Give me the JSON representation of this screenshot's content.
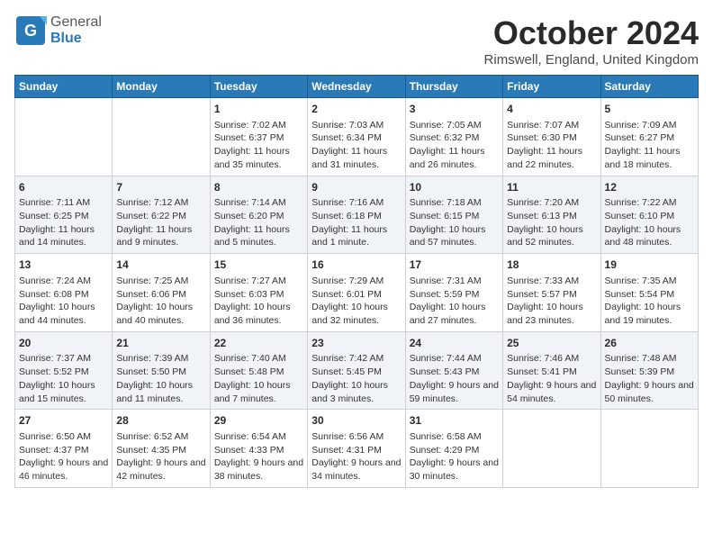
{
  "header": {
    "logo_general": "General",
    "logo_blue": "Blue",
    "month": "October 2024",
    "location": "Rimswell, England, United Kingdom"
  },
  "days_of_week": [
    "Sunday",
    "Monday",
    "Tuesday",
    "Wednesday",
    "Thursday",
    "Friday",
    "Saturday"
  ],
  "weeks": [
    [
      {
        "day": "",
        "info": ""
      },
      {
        "day": "",
        "info": ""
      },
      {
        "day": "1",
        "info": "Sunrise: 7:02 AM\nSunset: 6:37 PM\nDaylight: 11 hours and 35 minutes."
      },
      {
        "day": "2",
        "info": "Sunrise: 7:03 AM\nSunset: 6:34 PM\nDaylight: 11 hours and 31 minutes."
      },
      {
        "day": "3",
        "info": "Sunrise: 7:05 AM\nSunset: 6:32 PM\nDaylight: 11 hours and 26 minutes."
      },
      {
        "day": "4",
        "info": "Sunrise: 7:07 AM\nSunset: 6:30 PM\nDaylight: 11 hours and 22 minutes."
      },
      {
        "day": "5",
        "info": "Sunrise: 7:09 AM\nSunset: 6:27 PM\nDaylight: 11 hours and 18 minutes."
      }
    ],
    [
      {
        "day": "6",
        "info": "Sunrise: 7:11 AM\nSunset: 6:25 PM\nDaylight: 11 hours and 14 minutes."
      },
      {
        "day": "7",
        "info": "Sunrise: 7:12 AM\nSunset: 6:22 PM\nDaylight: 11 hours and 9 minutes."
      },
      {
        "day": "8",
        "info": "Sunrise: 7:14 AM\nSunset: 6:20 PM\nDaylight: 11 hours and 5 minutes."
      },
      {
        "day": "9",
        "info": "Sunrise: 7:16 AM\nSunset: 6:18 PM\nDaylight: 11 hours and 1 minute."
      },
      {
        "day": "10",
        "info": "Sunrise: 7:18 AM\nSunset: 6:15 PM\nDaylight: 10 hours and 57 minutes."
      },
      {
        "day": "11",
        "info": "Sunrise: 7:20 AM\nSunset: 6:13 PM\nDaylight: 10 hours and 52 minutes."
      },
      {
        "day": "12",
        "info": "Sunrise: 7:22 AM\nSunset: 6:10 PM\nDaylight: 10 hours and 48 minutes."
      }
    ],
    [
      {
        "day": "13",
        "info": "Sunrise: 7:24 AM\nSunset: 6:08 PM\nDaylight: 10 hours and 44 minutes."
      },
      {
        "day": "14",
        "info": "Sunrise: 7:25 AM\nSunset: 6:06 PM\nDaylight: 10 hours and 40 minutes."
      },
      {
        "day": "15",
        "info": "Sunrise: 7:27 AM\nSunset: 6:03 PM\nDaylight: 10 hours and 36 minutes."
      },
      {
        "day": "16",
        "info": "Sunrise: 7:29 AM\nSunset: 6:01 PM\nDaylight: 10 hours and 32 minutes."
      },
      {
        "day": "17",
        "info": "Sunrise: 7:31 AM\nSunset: 5:59 PM\nDaylight: 10 hours and 27 minutes."
      },
      {
        "day": "18",
        "info": "Sunrise: 7:33 AM\nSunset: 5:57 PM\nDaylight: 10 hours and 23 minutes."
      },
      {
        "day": "19",
        "info": "Sunrise: 7:35 AM\nSunset: 5:54 PM\nDaylight: 10 hours and 19 minutes."
      }
    ],
    [
      {
        "day": "20",
        "info": "Sunrise: 7:37 AM\nSunset: 5:52 PM\nDaylight: 10 hours and 15 minutes."
      },
      {
        "day": "21",
        "info": "Sunrise: 7:39 AM\nSunset: 5:50 PM\nDaylight: 10 hours and 11 minutes."
      },
      {
        "day": "22",
        "info": "Sunrise: 7:40 AM\nSunset: 5:48 PM\nDaylight: 10 hours and 7 minutes."
      },
      {
        "day": "23",
        "info": "Sunrise: 7:42 AM\nSunset: 5:45 PM\nDaylight: 10 hours and 3 minutes."
      },
      {
        "day": "24",
        "info": "Sunrise: 7:44 AM\nSunset: 5:43 PM\nDaylight: 9 hours and 59 minutes."
      },
      {
        "day": "25",
        "info": "Sunrise: 7:46 AM\nSunset: 5:41 PM\nDaylight: 9 hours and 54 minutes."
      },
      {
        "day": "26",
        "info": "Sunrise: 7:48 AM\nSunset: 5:39 PM\nDaylight: 9 hours and 50 minutes."
      }
    ],
    [
      {
        "day": "27",
        "info": "Sunrise: 6:50 AM\nSunset: 4:37 PM\nDaylight: 9 hours and 46 minutes."
      },
      {
        "day": "28",
        "info": "Sunrise: 6:52 AM\nSunset: 4:35 PM\nDaylight: 9 hours and 42 minutes."
      },
      {
        "day": "29",
        "info": "Sunrise: 6:54 AM\nSunset: 4:33 PM\nDaylight: 9 hours and 38 minutes."
      },
      {
        "day": "30",
        "info": "Sunrise: 6:56 AM\nSunset: 4:31 PM\nDaylight: 9 hours and 34 minutes."
      },
      {
        "day": "31",
        "info": "Sunrise: 6:58 AM\nSunset: 4:29 PM\nDaylight: 9 hours and 30 minutes."
      },
      {
        "day": "",
        "info": ""
      },
      {
        "day": "",
        "info": ""
      }
    ]
  ]
}
